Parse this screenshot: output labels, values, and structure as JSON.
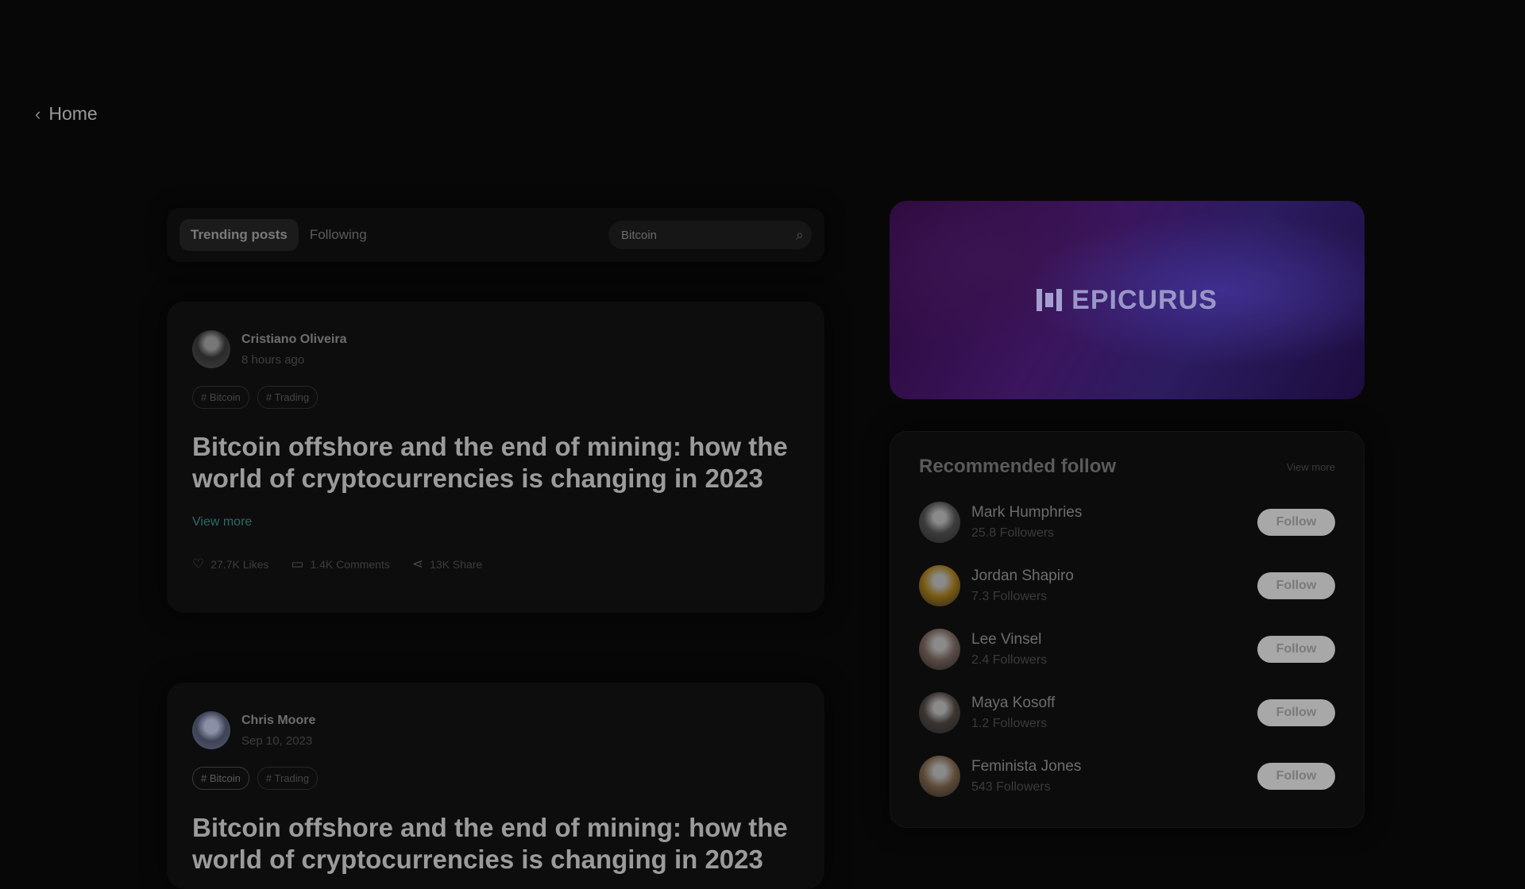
{
  "nav": {
    "back_label": "Home"
  },
  "feed": {
    "tabs": [
      {
        "label": "Trending posts",
        "active": true
      },
      {
        "label": "Following",
        "active": false
      }
    ],
    "search": {
      "value": "Bitcoin",
      "placeholder": "Search"
    },
    "posts": [
      {
        "author": "Cristiano Oliveira",
        "time": "8 hours ago",
        "tags": [
          "# Bitcoin",
          "# Trading"
        ],
        "title": "Bitcoin offshore and the end of mining: how the world of cryptocurrencies is changing in 2023",
        "view_more": "View more",
        "likes": "27.7K Likes",
        "comments": "1.4K Comments",
        "shares": "13K Share"
      },
      {
        "author": "Chris Moore",
        "time": "Sep 10, 2023",
        "tags": [
          "# Bitcoin",
          "# Trading"
        ],
        "title": "Bitcoin offshore and the end of mining: how the world of cryptocurrencies is changing in 2023"
      }
    ]
  },
  "banner": {
    "brand": "EPICURUS"
  },
  "recommended": {
    "title": "Recommended follow",
    "view_all": "View more",
    "follow_label": "Follow",
    "people": [
      {
        "name": "Mark Humphries",
        "followers": "25.8 Followers",
        "avatar_color": "#3c3c3c"
      },
      {
        "name": "Jordan Shapiro",
        "followers": "7.3 Followers",
        "avatar_color": "#7a5a12"
      },
      {
        "name": "Lee Vinsel",
        "followers": "2.4 Followers",
        "avatar_color": "#5a4a44"
      },
      {
        "name": "Maya Kosoff",
        "followers": "1.2 Followers",
        "avatar_color": "#3a3430"
      },
      {
        "name": "Feminista Jones",
        "followers": "543 Followers",
        "avatar_color": "#5e4a36"
      }
    ]
  }
}
